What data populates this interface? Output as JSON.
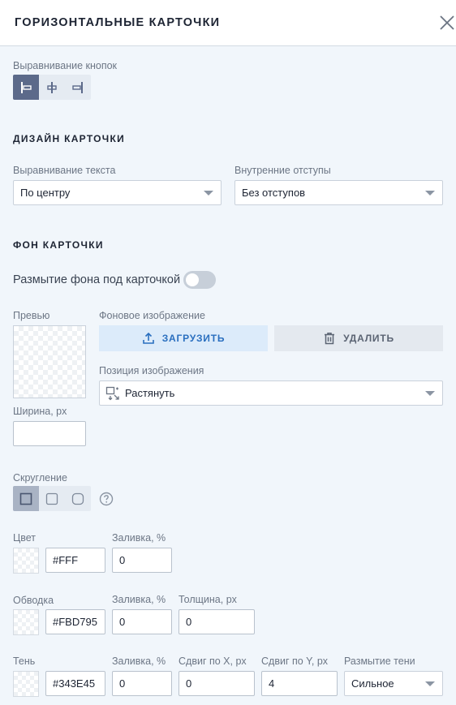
{
  "header": {
    "title": "ГОРИЗОНТАЛЬНЫЕ КАРТОЧКИ"
  },
  "buttons_alignment": {
    "label": "Выравнивание кнопок"
  },
  "card_design": {
    "title": "ДИЗАЙН КАРТОЧКИ",
    "text_align_label": "Выравнивание текста",
    "text_align_value": "По центру",
    "padding_label": "Внутренние отступы",
    "padding_value": "Без отступов"
  },
  "card_bg": {
    "title": "ФОН КАРТОЧКИ",
    "blur_label": "Размытие фона под карточкой",
    "preview_label": "Превью",
    "bg_image_label": "Фоновое изображение",
    "upload_label": "ЗАГРУЗИТЬ",
    "delete_label": "УДАЛИТЬ",
    "position_label": "Позиция изображения",
    "position_value": "Растянуть",
    "width_label": "Ширина, px",
    "width_value": ""
  },
  "rounding": {
    "label": "Скругление"
  },
  "color": {
    "label": "Цвет",
    "hex": "#FFF",
    "fill_label": "Заливка, %",
    "fill_value": "0"
  },
  "border": {
    "label": "Обводка",
    "hex": "#FBD795",
    "fill_label": "Заливка, %",
    "fill_value": "0",
    "thickness_label": "Толщина, px",
    "thickness_value": "0"
  },
  "shadow": {
    "label": "Тень",
    "hex": "#343E45",
    "fill_label": "Заливка, %",
    "fill_value": "0",
    "offset_x_label": "Сдвиг по X, px",
    "offset_x_value": "0",
    "offset_y_label": "Сдвиг по Y, px",
    "offset_y_value": "4",
    "blur_label": "Размытие тени",
    "blur_value": "Сильное"
  }
}
